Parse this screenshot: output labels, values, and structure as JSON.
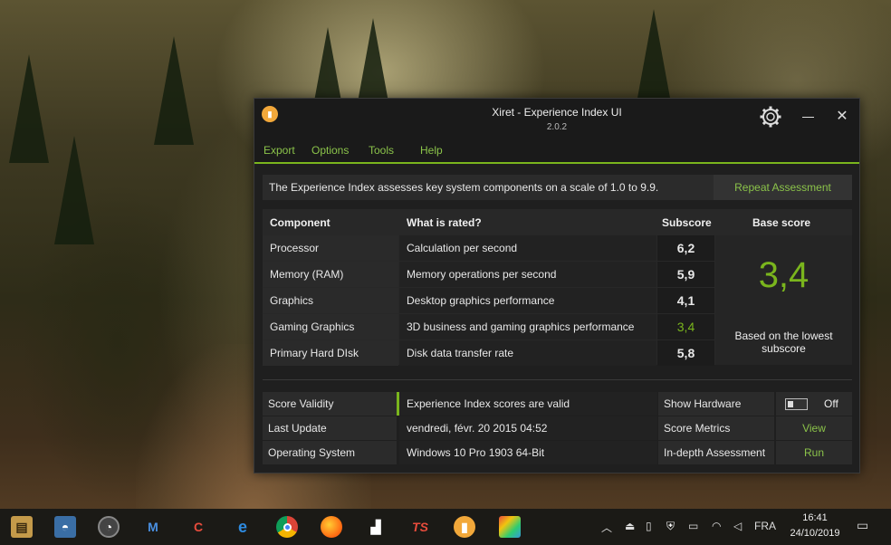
{
  "window": {
    "title": "Xiret - Experience Index UI",
    "version": "2.0.2",
    "icon_name": "xiret-app-icon"
  },
  "menu": [
    "Export",
    "Options",
    "Tools",
    "Help"
  ],
  "info_bar": {
    "text": "The Experience Index assesses key system components on a scale of 1.0 to 9.9.",
    "button": "Repeat Assessment"
  },
  "score_table": {
    "headers": {
      "component": "Component",
      "rated": "What is rated?",
      "subscore": "Subscore",
      "base": "Base score"
    },
    "rows": [
      {
        "component": "Processor",
        "rated": "Calculation per second",
        "subscore": "6,2"
      },
      {
        "component": "Memory (RAM)",
        "rated": "Memory operations per second",
        "subscore": "5,9"
      },
      {
        "component": "Graphics",
        "rated": "Desktop graphics performance",
        "subscore": "4,1"
      },
      {
        "component": "Gaming Graphics",
        "rated": "3D business and gaming graphics performance",
        "subscore": "3,4"
      },
      {
        "component": "Primary Hard DIsk",
        "rated": "Disk data transfer rate",
        "subscore": "5,8"
      }
    ],
    "base_score": "3,4",
    "base_note": "Based on the lowest subscore",
    "accent_color": "#7ab51d"
  },
  "info_table": {
    "rows": [
      {
        "key": "Score Validity",
        "value": "Experience Index scores are valid",
        "key2": "Show Hardware",
        "action": "Off"
      },
      {
        "key": "Last Update",
        "value": "vendredi, févr. 20 2015 04:52",
        "key2": "Score Metrics",
        "action": "View"
      },
      {
        "key": "Operating System",
        "value": "Windows 10 Pro 1903 64-Bit",
        "key2": "In-depth Assessment",
        "action": "Run"
      }
    ]
  },
  "taskbar": {
    "language": "FRA",
    "time": "16:41",
    "date": "24/10/2019",
    "apps": [
      "explorer-icon",
      "network-drive-icon",
      "speedometer-icon",
      "malwarebytes-icon",
      "ccleaner-icon",
      "edge-icon",
      "chrome-icon",
      "firefox-icon",
      "stairs-app-icon",
      "ts-app-icon",
      "xiret-icon",
      "color-app-icon"
    ]
  }
}
